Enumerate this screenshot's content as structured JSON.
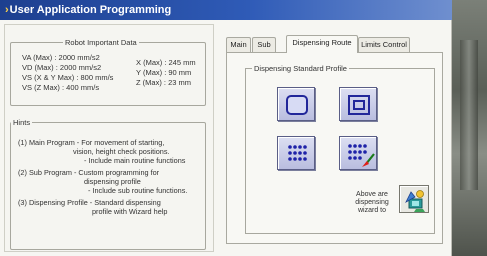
{
  "window": {
    "title": "User Application Programming"
  },
  "robot_data": {
    "title": "Robot Important Data",
    "specs_left": [
      "VA (Max) : 2000 mm/s2",
      "VD (Max) : 2000 mm/s2",
      "VS (X & Y Max) : 800 mm/s",
      "VS (Z Max) :   400 mm/s"
    ],
    "specs_right": [
      "X (Max) : 245 mm",
      "Y (Max) : 90 mm",
      "Z (Max) : 23 mm"
    ]
  },
  "hints": {
    "title": "Hints",
    "lines": [
      "(1) Main Program - For movement of starting,",
      "vision, height check positions.",
      "- Include main routine functions",
      "(2) Sub Program - Custom programming for",
      "dispensing profile",
      "- Include sub routine functions.",
      "(3) Dispensing Profile - Standard dispensing",
      "profile with Wizard help"
    ]
  },
  "tabs": [
    {
      "label": "Main"
    },
    {
      "label": "Sub"
    },
    {
      "label": "Dispensing Route"
    },
    {
      "label": "Limits Control"
    }
  ],
  "dispensing": {
    "group_title": "Dispensing Standard Profile",
    "profiles": [
      {
        "icon": "rounded-rectangle-icon"
      },
      {
        "icon": "nested-rectangles-icon"
      },
      {
        "icon": "dot-grid-icon"
      },
      {
        "icon": "dot-grid-brush-icon"
      }
    ],
    "wizard_text": "Above are dispensing wizard to",
    "wizard_icon": "wizard-icon"
  }
}
